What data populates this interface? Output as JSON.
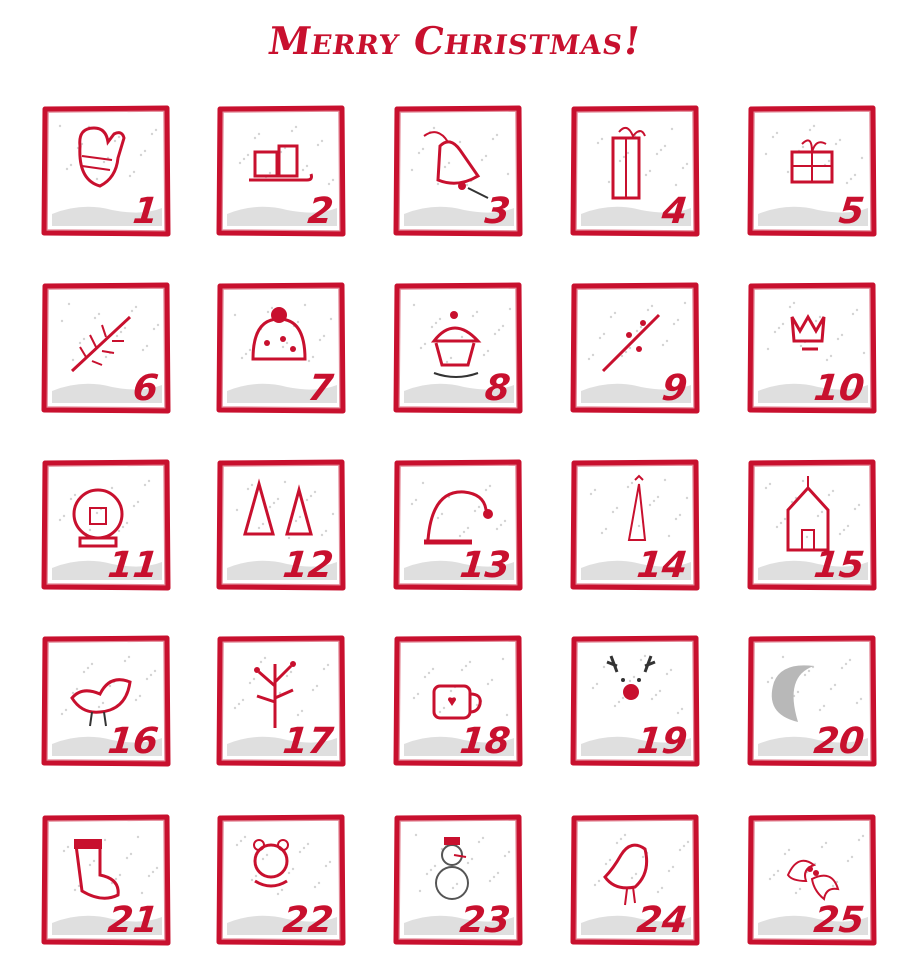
{
  "title": "Merry Christmas!",
  "colors": {
    "accent": "#c8102e",
    "snow": "#b8b8b8",
    "background": "#ffffff"
  },
  "calendar": {
    "days": [
      {
        "number": "1",
        "icon": "mitten-icon"
      },
      {
        "number": "2",
        "icon": "gift-sled-icon"
      },
      {
        "number": "3",
        "icon": "bell-icon"
      },
      {
        "number": "4",
        "icon": "tall-gift-icon"
      },
      {
        "number": "5",
        "icon": "gift-box-icon"
      },
      {
        "number": "6",
        "icon": "pine-branch-icon"
      },
      {
        "number": "7",
        "icon": "knit-hat-icon"
      },
      {
        "number": "8",
        "icon": "pudding-icon"
      },
      {
        "number": "9",
        "icon": "berry-branch-icon"
      },
      {
        "number": "10",
        "icon": "crown-icon"
      },
      {
        "number": "11",
        "icon": "snow-globe-icon"
      },
      {
        "number": "12",
        "icon": "trees-icon"
      },
      {
        "number": "13",
        "icon": "santa-hat-icon"
      },
      {
        "number": "14",
        "icon": "thin-tree-icon"
      },
      {
        "number": "15",
        "icon": "church-icon"
      },
      {
        "number": "16",
        "icon": "bird-icon"
      },
      {
        "number": "17",
        "icon": "berry-tree-icon"
      },
      {
        "number": "18",
        "icon": "cocoa-mug-icon"
      },
      {
        "number": "19",
        "icon": "reindeer-icon"
      },
      {
        "number": "20",
        "icon": "moon-icon"
      },
      {
        "number": "21",
        "icon": "stocking-icon"
      },
      {
        "number": "22",
        "icon": "bear-icon"
      },
      {
        "number": "23",
        "icon": "snowman-icon"
      },
      {
        "number": "24",
        "icon": "robin-icon"
      },
      {
        "number": "25",
        "icon": "holly-icon"
      }
    ]
  }
}
